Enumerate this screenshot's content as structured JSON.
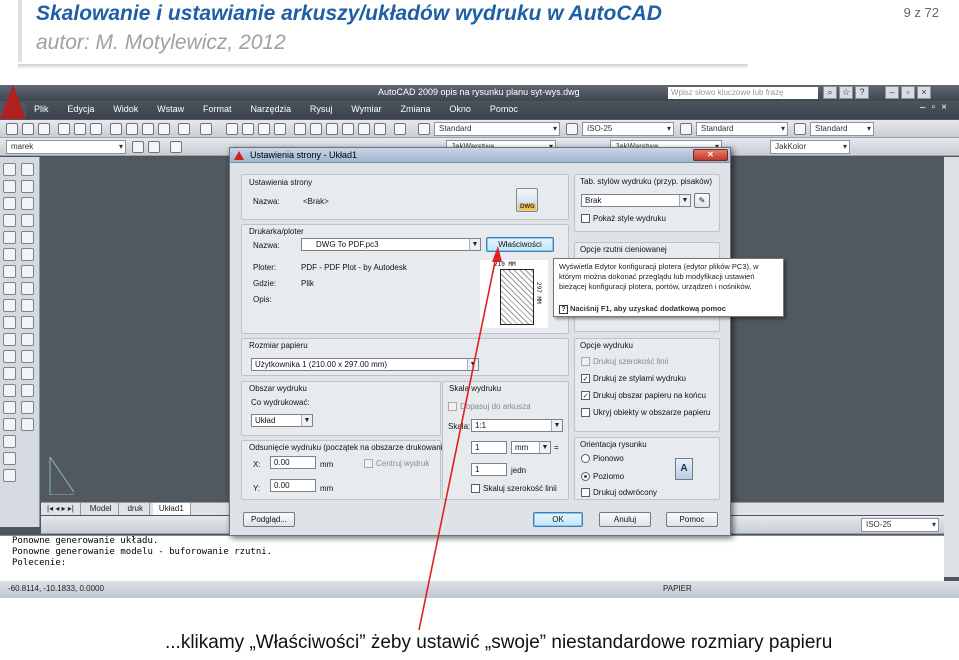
{
  "slide": {
    "title": "Skalowanie i ustawianie arkuszy/układów wydruku w AutoCAD",
    "subtitle": "autor: M. Motylewicz, 2012",
    "page_number": "9 z 72",
    "caption": "...klikamy „Właściwości” żeby ustawić „swoje” niestandardowe rozmiary papieru"
  },
  "app": {
    "window_title": "AutoCAD 2009 opis na rysunku planu syt-wys.dwg",
    "search_placeholder": "Wpisz słowo kluczowe lub frazę",
    "menu": [
      "Plik",
      "Edycja",
      "Widok",
      "Wstaw",
      "Format",
      "Narzędzia",
      "Rysuj",
      "Wymiar",
      "Zmiana",
      "Okno",
      "Pomoc"
    ],
    "toolbar": {
      "text_style": "Standard",
      "dim_style": "ISO-25",
      "table_style": "Standard",
      "mleader_style": "Standard",
      "workspace": "marek",
      "layer": "JakWarstwa",
      "color": "JakKolor",
      "linetype": "JakWarstwa",
      "lineweight": "JakWarstwa"
    },
    "layout_tabs": [
      "Model",
      "druk",
      "Układ1"
    ],
    "snap_dimstyle": "ISO-25",
    "command_lines": [
      "Ponowne generowanie układu.",
      "Ponowne generowanie modelu - buforowanie rzutni.",
      "",
      "Polecenie:"
    ],
    "coordinates": "-60.8114, -10.1833, 0.0000",
    "space": "PAPIER"
  },
  "dialog": {
    "title": "Ustawienia strony - Układ1",
    "page_setup": {
      "group": "Ustawienia strony",
      "name_label": "Nazwa:",
      "name_value": "<Brak>",
      "dwg_badge": "DWG"
    },
    "plotter": {
      "group": "Drukarka/ploter",
      "name_label": "Nazwa:",
      "device": "DWG To PDF.pc3",
      "properties_button": "Właściwości",
      "plotter_label": "Ploter:",
      "plotter_value": "PDF - PDF Plot - by Autodesk",
      "where_label": "Gdzie:",
      "where_value": "Plik",
      "desc_label": "Opis:",
      "preview_width": "210 MM",
      "preview_height": "297 MM"
    },
    "paper_size": {
      "group": "Rozmiar papieru",
      "value": "Użytkownika 1 (210.00 x 297.00 mm)"
    },
    "plot_area": {
      "group": "Obszar wydruku",
      "what_label": "Co wydrukować:",
      "what_value": "Układ"
    },
    "plot_offset": {
      "group": "Odsunięcie wydruku (początek na obszarze drukowania)",
      "x_label": "X:",
      "x_value": "0.00",
      "y_label": "Y:",
      "y_value": "0.00",
      "unit": "mm",
      "center_label": "Centruj wydruk"
    },
    "plot_scale": {
      "group": "Skala wydruku",
      "fit_label": "Dopasuj do arkusza",
      "scale_label": "Skala:",
      "scale_value": "1:1",
      "num1": "1",
      "unit_value": "mm",
      "eq": "=",
      "num2": "1",
      "unit2": "jedn",
      "lineweights_label": "Skaluj szerokość linii"
    },
    "plot_style_table": {
      "group": "Tab. stylów wydruku (przyp. pisaków)",
      "value": "Brak",
      "show_label": "Pokaż style wydruku"
    },
    "shaded_viewport": {
      "group": "Opcje rzutni cieniowanej"
    },
    "plot_options": {
      "group": "Opcje wydruku",
      "opt1": "Drukuj szerokość linii",
      "opt2": "Drukuj ze stylami wydruku",
      "opt3": "Drukuj obszar papieru na końcu",
      "opt4": "Ukryj obiekty w obszarze papieru"
    },
    "orientation": {
      "group": "Orientacja rysunku",
      "portrait": "Pionowo",
      "landscape": "Poziomo",
      "upside_down": "Drukuj odwrócony",
      "icon": "A"
    },
    "buttons": {
      "preview": "Podgląd...",
      "ok": "OK",
      "cancel": "Anuluj",
      "help": "Pomoc"
    }
  },
  "tooltip": {
    "text": "Wyświetla Edytor konfiguracji plotera (edytor plików PC3), w którym można dokonać przeglądu lub modyfikacji ustawień bieżącej konfiguracji plotera, portów, urządzeń i nośników.",
    "hint": "Naciśnij F1, aby uzyskać dodatkową pomoc"
  },
  "colors": {
    "title_blue": "#1f5fa7",
    "arrow_red": "#e02020",
    "autocad_dark": "#4c5560"
  }
}
